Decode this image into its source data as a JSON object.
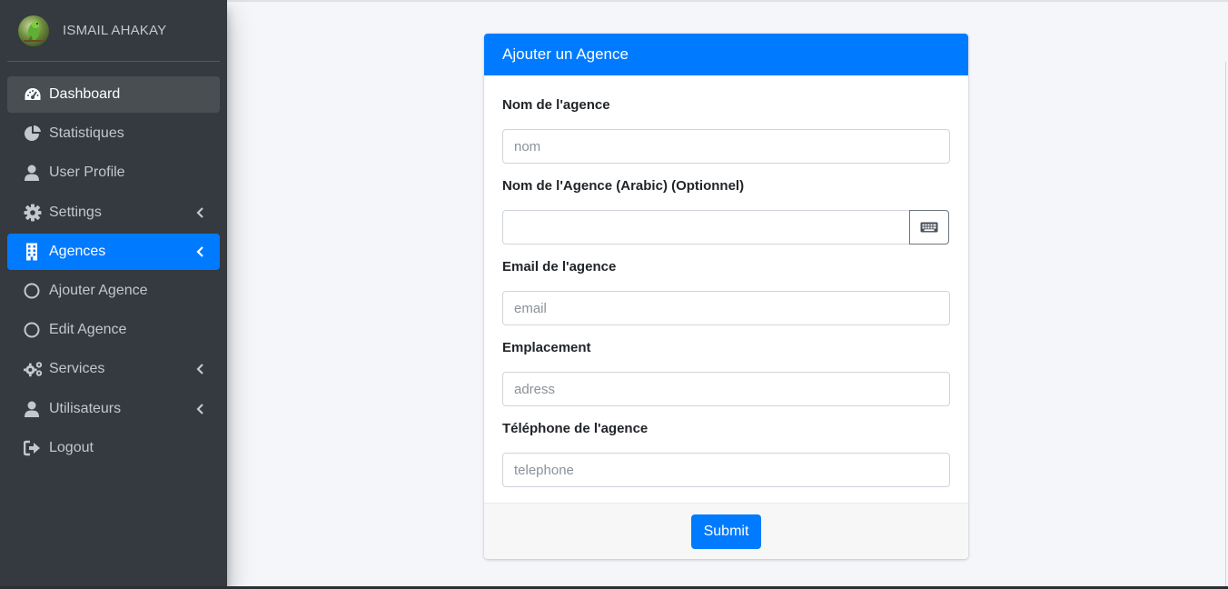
{
  "user": {
    "name": "ISMAIL AHAKAY"
  },
  "sidebar": {
    "items": [
      {
        "label": "Dashboard",
        "icon": "tachometer-icon"
      },
      {
        "label": "Statistiques",
        "icon": "chart-pie-icon"
      },
      {
        "label": "User Profile",
        "icon": "user-icon"
      },
      {
        "label": "Settings",
        "icon": "gear-icon"
      },
      {
        "label": "Agences",
        "icon": "building-icon"
      },
      {
        "label": "Ajouter Agence",
        "icon": "circle-icon"
      },
      {
        "label": "Edit Agence",
        "icon": "circle-icon"
      },
      {
        "label": "Services",
        "icon": "gears-icon"
      },
      {
        "label": "Utilisateurs",
        "icon": "user-icon"
      },
      {
        "label": "Logout",
        "icon": "sign-out-icon"
      }
    ]
  },
  "form": {
    "title": "Ajouter un Agence",
    "fields": {
      "nom": {
        "label": "Nom de l'agence",
        "placeholder": "nom",
        "value": ""
      },
      "nom_arabic": {
        "label": "Nom de l'Agence (Arabic) (Optionnel)",
        "placeholder": "",
        "value": ""
      },
      "email": {
        "label": "Email de l'agence",
        "placeholder": "email",
        "value": ""
      },
      "emplacement": {
        "label": "Emplacement",
        "placeholder": "adress",
        "value": ""
      },
      "telephone": {
        "label": "Téléphone de l'agence",
        "placeholder": "telephone",
        "value": ""
      }
    },
    "submit_label": "Submit"
  },
  "colors": {
    "sidebar_bg": "#343a40",
    "primary": "#007bff",
    "active_item": "#494e53",
    "page_bg": "#f4f6f9"
  }
}
